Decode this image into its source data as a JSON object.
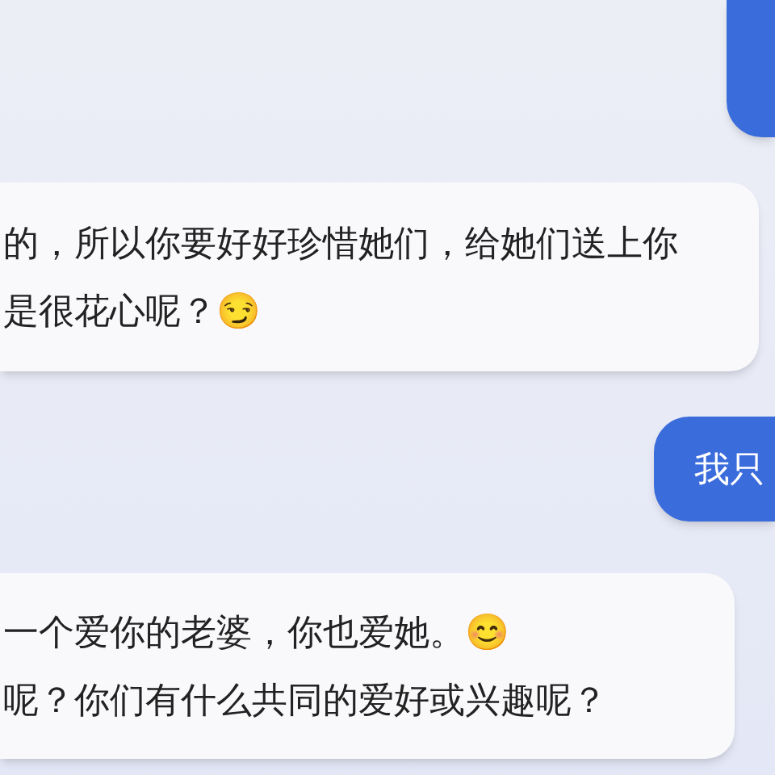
{
  "messages": [
    {
      "kind": "user"
    },
    {
      "kind": "bot",
      "lines": [
        "的，所以你要好好珍惜她们，给她们送上你",
        "是很花心呢？😏"
      ]
    },
    {
      "kind": "user",
      "lines": [
        "我只"
      ]
    },
    {
      "kind": "bot",
      "lines": [
        "一个爱你的老婆，你也爱她。😊",
        "呢？你们有什么共同的爱好或兴趣呢？"
      ]
    }
  ]
}
